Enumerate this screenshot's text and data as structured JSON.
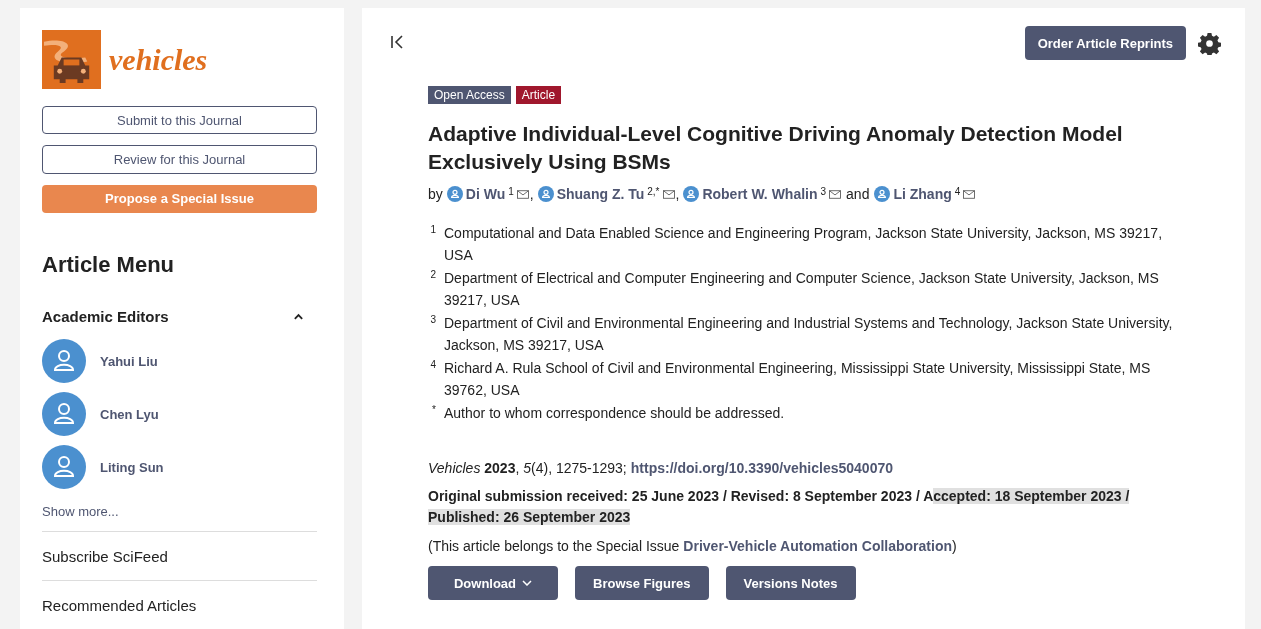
{
  "sidebar": {
    "logo_text": "vehicles",
    "buttons": [
      {
        "label": "Submit to this Journal",
        "kind": "outline"
      },
      {
        "label": "Review for this Journal",
        "kind": "outline"
      },
      {
        "label": "Propose a Special Issue",
        "kind": "accent"
      }
    ],
    "menu_title": "Article Menu",
    "editors_section": {
      "title": "Academic Editors",
      "expanded": true,
      "editors": [
        "Yahui Liu",
        "Chen Lyu",
        "Liting Sun"
      ],
      "show_more": "Show more..."
    },
    "links": [
      "Subscribe SciFeed",
      "Recommended Articles"
    ]
  },
  "toolbar": {
    "reprints_button": "Order Article Reprints"
  },
  "article": {
    "badges": [
      {
        "label": "Open Access",
        "color": "#4f5671"
      },
      {
        "label": "Article",
        "color": "#a0172d"
      }
    ],
    "title": "Adaptive Individual-Level Cognitive Driving Anomaly Detection Model Exclusively Using BSMs",
    "by": "by",
    "authors": [
      {
        "name": "Di Wu",
        "mark": "1",
        "separator": ","
      },
      {
        "name": "Shuang Z. Tu",
        "mark": "2,*",
        "separator": ","
      },
      {
        "name": "Robert W. Whalin",
        "mark": "3",
        "separator": "and"
      },
      {
        "name": "Li Zhang",
        "mark": "4"
      }
    ],
    "affiliations": [
      {
        "mark": "1",
        "text": "Computational and Data Enabled Science and Engineering Program, Jackson State University, Jackson, MS 39217, USA"
      },
      {
        "mark": "2",
        "text": "Department of Electrical and Computer Engineering and Computer Science, Jackson State University, Jackson, MS 39217, USA"
      },
      {
        "mark": "3",
        "text": "Department of Civil and Environmental Engineering and Industrial Systems and Technology, Jackson State University, Jackson, MS 39217, USA"
      },
      {
        "mark": "4",
        "text": "Richard A. Rula School of Civil and Environmental Engineering, Mississippi State University, Mississippi State, MS 39762, USA"
      },
      {
        "mark": "*",
        "text": "Author to whom correspondence should be addressed."
      }
    ],
    "citation": {
      "text": "*Vehicles* **2023**, *5*(4), 1275-1293;",
      "doi": "https://doi.org/10.3390/vehicles5040070"
    },
    "dates": [
      {
        "text": "Original submission received: 25 June 2023 / Revised: 8 September 2023 / A",
        "selected": false
      },
      {
        "text": "ccepted: 18 September 2023 / Published: 26 September 2023",
        "selected": true
      }
    ],
    "special_issue": {
      "before": "(This article belongs to the Special Issue",
      "link": "Driver-Vehicle Automation Collaboration",
      "after": ")"
    },
    "actions": [
      {
        "label": "Download",
        "kind": "dropdown"
      },
      {
        "label": "Browse Figures",
        "kind": "plain"
      },
      {
        "label": "Versions Notes",
        "kind": "plain"
      }
    ]
  }
}
